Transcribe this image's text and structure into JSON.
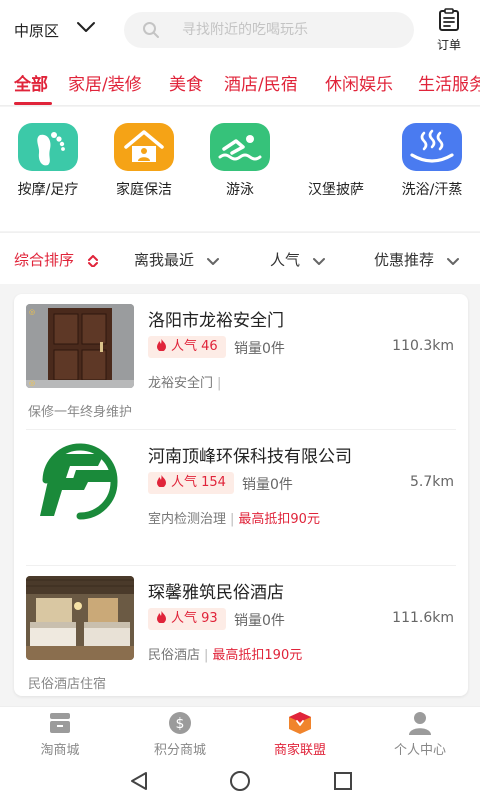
{
  "header": {
    "district": "中原区",
    "search_placeholder": "寻找附近的吃喝玩乐",
    "order_label": "订单"
  },
  "categories": [
    "全部",
    "家居/装修",
    "美食",
    "酒店/民宿",
    "休闲娱乐",
    "生活服务"
  ],
  "services": [
    {
      "label": "按摩/足疗",
      "icon": "foot-massage-icon",
      "color": "#3cc9a8"
    },
    {
      "label": "家庭保洁",
      "icon": "house-cleaning-icon",
      "color": "#f5a316"
    },
    {
      "label": "游泳",
      "icon": "swimming-icon",
      "color": "#36c27a"
    },
    {
      "label": "汉堡披萨",
      "icon": "burger-pizza-icon",
      "color": "#ffffff"
    },
    {
      "label": "洗浴/汗蒸",
      "icon": "hot-spring-icon",
      "color": "#4a7bf0"
    }
  ],
  "pager": {
    "count": 5,
    "active": 0
  },
  "sort": {
    "items": [
      "综合排序",
      "离我最近",
      "人气",
      "优惠推荐"
    ],
    "active": 0
  },
  "shops": [
    {
      "name": "洛阳市龙裕安全门",
      "popularity": "人气 46",
      "sales": "销量0件",
      "distance": "110.3km",
      "category": "龙裕安全门",
      "promo": "",
      "desc": "保修一年终身维护"
    },
    {
      "name": "河南顶峰环保科技有限公司",
      "popularity": "人气 154",
      "sales": "销量0件",
      "distance": "5.7km",
      "category": "室内检测治理",
      "promo": "最高抵扣90元",
      "desc": ""
    },
    {
      "name": "琛馨雅筑民俗酒店",
      "popularity": "人气 93",
      "sales": "销量0件",
      "distance": "111.6km",
      "category": "民俗酒店",
      "promo": "最高抵扣190元",
      "desc": "民俗酒店住宿"
    }
  ],
  "bottom_nav": [
    {
      "label": "淘商城",
      "icon": "shop-icon"
    },
    {
      "label": "积分商城",
      "icon": "coin-icon"
    },
    {
      "label": "商家联盟",
      "icon": "merchant-box-icon"
    },
    {
      "label": "个人中心",
      "icon": "user-icon"
    }
  ],
  "bottom_nav_active": 2,
  "colors": {
    "accent": "#e0243a",
    "pager_active": "#2f8bd9"
  }
}
